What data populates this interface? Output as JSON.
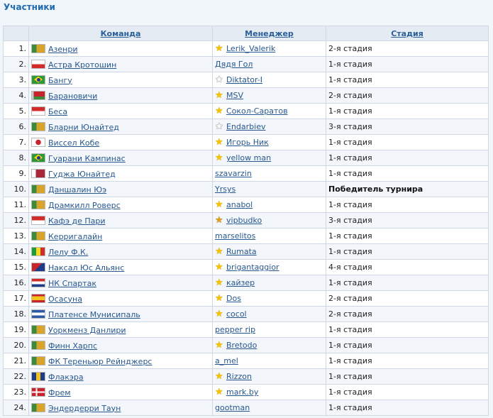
{
  "page_title": "Участники",
  "headers": {
    "num": "",
    "team": "Команда",
    "manager": "Менеджер",
    "stage": "Стадия"
  },
  "rows": [
    {
      "num": "1.",
      "team": "Азенри",
      "flag": "f-green",
      "manager": "Lerik_Valerik",
      "star": "gold",
      "stage": "2-я стадия"
    },
    {
      "num": "2.",
      "team": "Астра Кротошин",
      "flag": "f-redwhite",
      "manager": "Дядя Гол",
      "star": "",
      "stage": "1-я стадия"
    },
    {
      "num": "3.",
      "team": "Бангу",
      "flag": "f-brazil",
      "manager": "Diktator-I",
      "star": "silver",
      "stage": "1-я стадия"
    },
    {
      "num": "4.",
      "team": "Барановичи",
      "flag": "f-belarus",
      "manager": "MSV",
      "star": "gold",
      "stage": "2-я стадия"
    },
    {
      "num": "5.",
      "team": "Беса",
      "flag": "f-whitered",
      "manager": "Сокол-Саратов",
      "star": "gold",
      "stage": "1-я стадия"
    },
    {
      "num": "6.",
      "team": "Бларни Юнайтед",
      "flag": "f-green",
      "manager": "Endarbiev",
      "star": "silver",
      "stage": "3-я стадия"
    },
    {
      "num": "7.",
      "team": "Виссел Кобе",
      "flag": "f-japan",
      "manager": "Игорь Ник",
      "star": "gold",
      "stage": "1-я стадия"
    },
    {
      "num": "8.",
      "team": "Гуарани Кампинас",
      "flag": "f-brazil",
      "manager": "yellow man",
      "star": "gold",
      "stage": "1-я стадия"
    },
    {
      "num": "9.",
      "team": "Гуджа Юнайтед",
      "flag": "f-qatar",
      "manager": "szavarzin",
      "star": "",
      "stage": "1-я стадия"
    },
    {
      "num": "10.",
      "team": "Даншалин Юэ",
      "flag": "f-green",
      "manager": "Yrsys",
      "star": "",
      "stage": "Победитель турнира",
      "winner": true
    },
    {
      "num": "11.",
      "team": "Драмкилл Роверс",
      "flag": "f-green",
      "manager": "anabol",
      "star": "gold",
      "stage": "1-я стадия"
    },
    {
      "num": "12.",
      "team": "Кафэ де Пари",
      "flag": "f-whitered",
      "manager": "vipbudko",
      "star": "bronze",
      "stage": "3-я стадия"
    },
    {
      "num": "13.",
      "team": "Керригалайн",
      "flag": "f-green",
      "manager": "marselitos",
      "star": "",
      "stage": "1-я стадия"
    },
    {
      "num": "14.",
      "team": "Лелу Ф.К.",
      "flag": "f-senegal",
      "manager": "Rumata",
      "star": "gold",
      "stage": "1-я стадия"
    },
    {
      "num": "15.",
      "team": "Наксал Юс Альянс",
      "flag": "f-nepal",
      "manager": "brigantaggior",
      "star": "gold",
      "stage": "4-я стадия"
    },
    {
      "num": "16.",
      "team": "НК Спартак",
      "flag": "f-croatia",
      "manager": "кайзер",
      "star": "gold",
      "stage": "1-я стадия"
    },
    {
      "num": "17.",
      "team": "Осасуна",
      "flag": "f-spain",
      "manager": "Dos",
      "star": "gold",
      "stage": "2-я стадия"
    },
    {
      "num": "18.",
      "team": "Платенсе Мунисипаль",
      "flag": "f-arg",
      "manager": "cocol",
      "star": "gold",
      "stage": "2-я стадия"
    },
    {
      "num": "19.",
      "team": "Уоркменз Данлири",
      "flag": "f-green",
      "manager": "pepper rip",
      "star": "",
      "stage": "1-я стадия"
    },
    {
      "num": "20.",
      "team": "Финн Харпс",
      "flag": "f-green",
      "manager": "Bretodo",
      "star": "gold",
      "stage": "1-я стадия"
    },
    {
      "num": "21.",
      "team": "ФК Тереньюр Рейнджерс",
      "flag": "f-green",
      "manager": "a_mel",
      "star": "",
      "stage": "1-я стадия"
    },
    {
      "num": "22.",
      "team": "Флакэра",
      "flag": "f-barb",
      "manager": "Rizzon",
      "star": "gold",
      "stage": "1-я стадия"
    },
    {
      "num": "23.",
      "team": "Фрем",
      "flag": "f-den",
      "manager": "mark.by",
      "star": "gold",
      "stage": "1-я стадия"
    },
    {
      "num": "24.",
      "team": "Эндердерри Таун",
      "flag": "f-green",
      "manager": "gootman",
      "star": "",
      "stage": "1-я стадия"
    }
  ]
}
